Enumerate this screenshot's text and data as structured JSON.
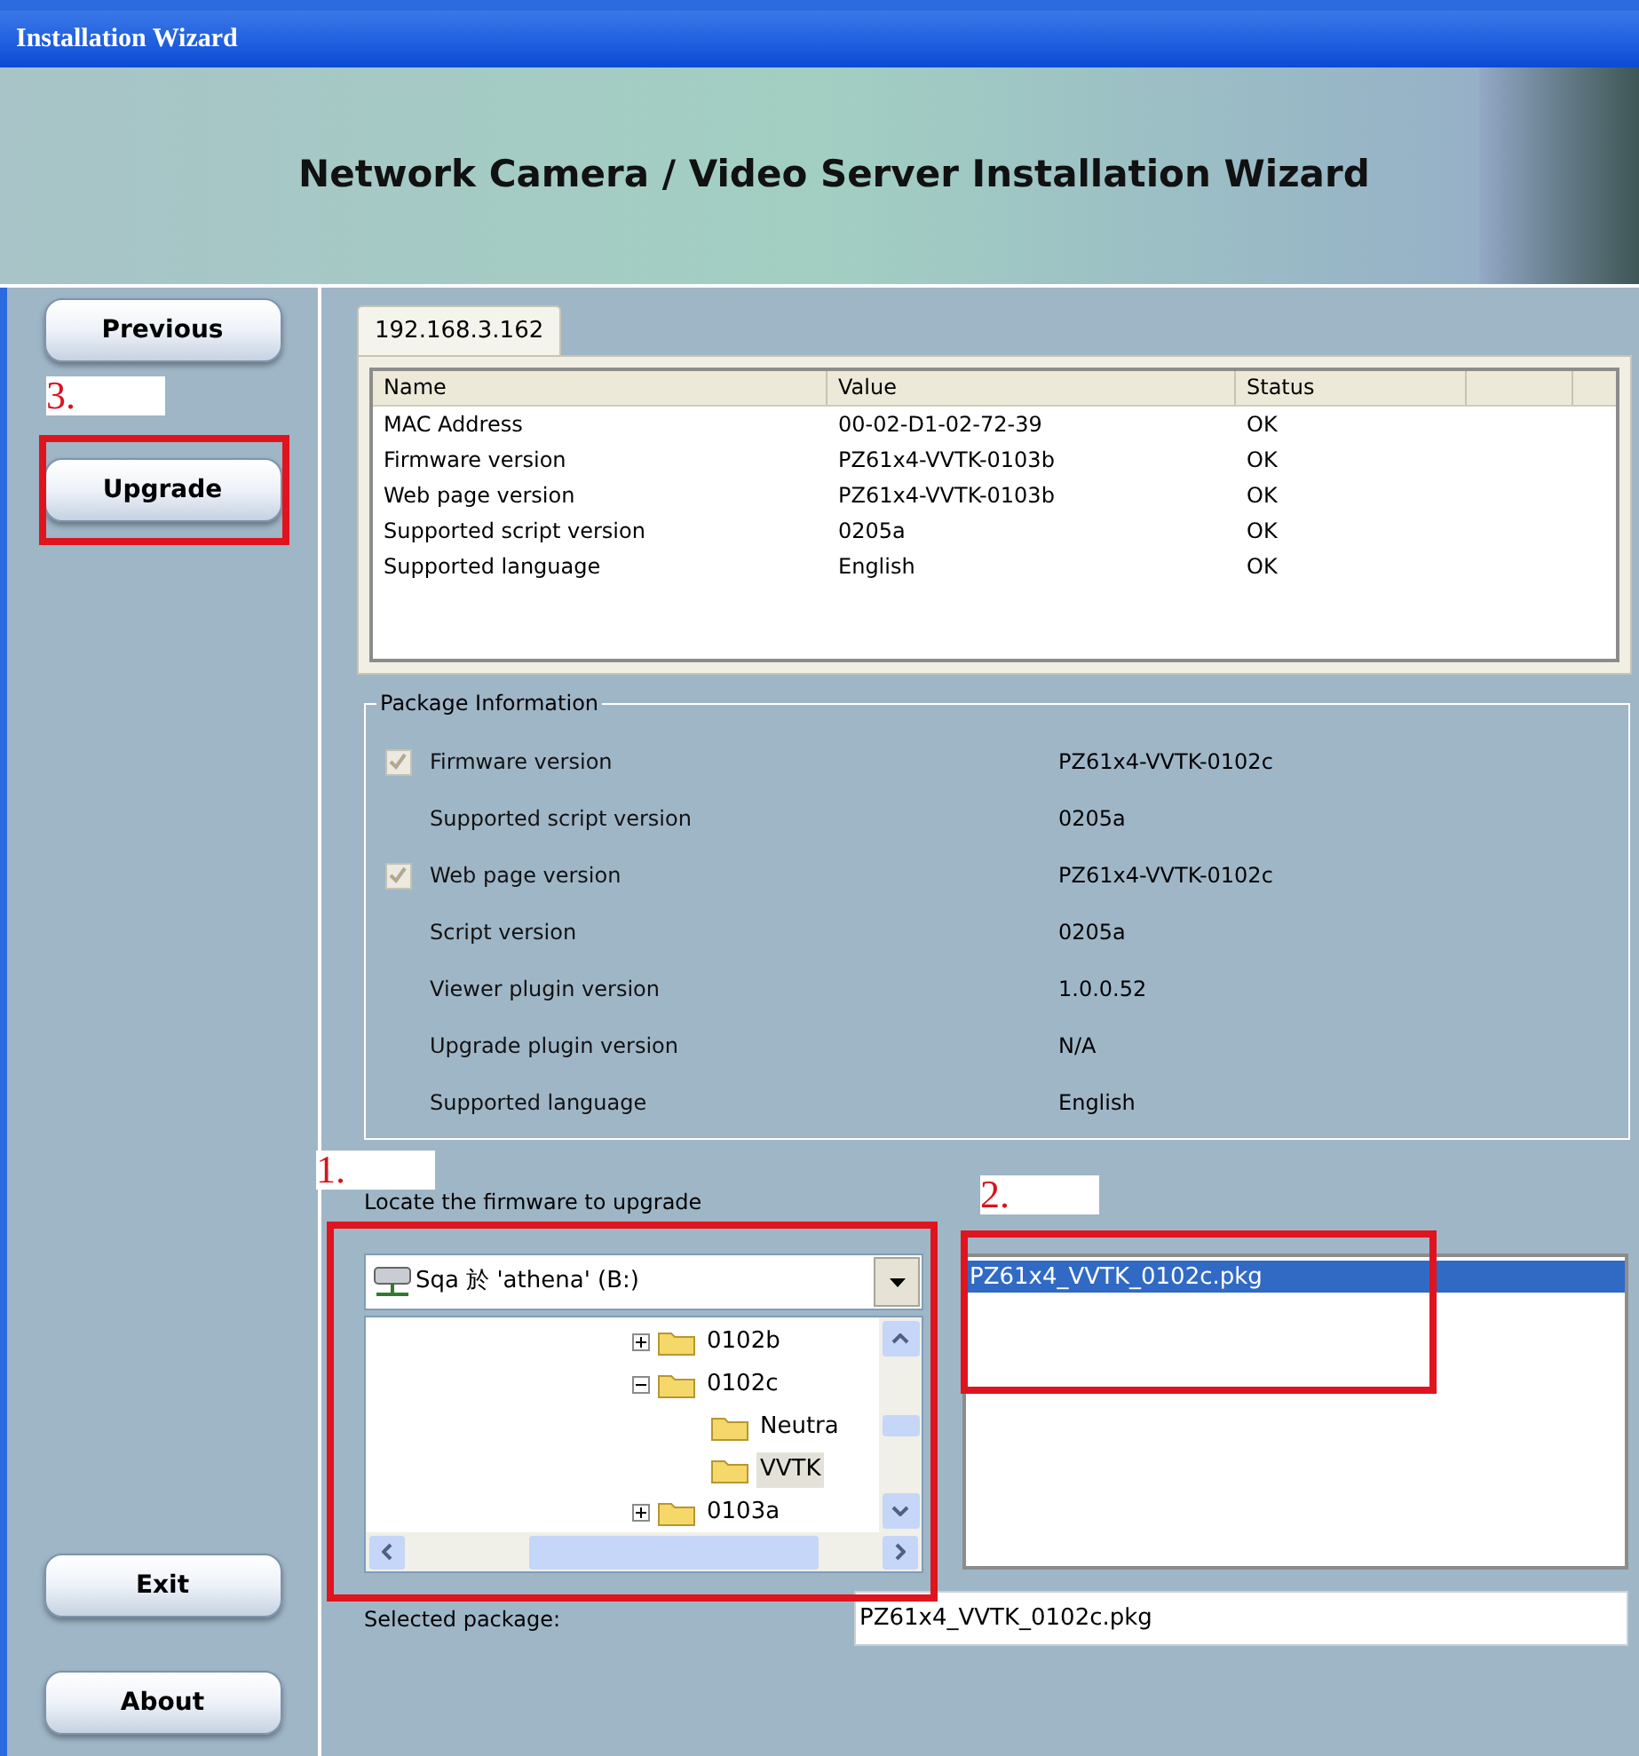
{
  "window": {
    "title": "Installation Wizard"
  },
  "banner": {
    "title": "Network Camera / Video Server Installation Wizard"
  },
  "sidebar": {
    "top_buttons": [
      "Previous",
      "Upgrade"
    ],
    "bottom_buttons": [
      "Exit",
      "About"
    ]
  },
  "device_tab": {
    "label": "192.168.3.162",
    "selected": true
  },
  "device_table": {
    "columns": [
      "Name",
      "Value",
      "Status"
    ],
    "rows": [
      [
        "MAC Address",
        "00-02-D1-02-72-39",
        "OK"
      ],
      [
        "Firmware version",
        "PZ61x4-VVTK-0103b",
        "OK"
      ],
      [
        "Web page version",
        "PZ61x4-VVTK-0103b",
        "OK"
      ],
      [
        "Supported script version",
        "0205a",
        "OK"
      ],
      [
        "Supported language",
        "English",
        "OK"
      ]
    ]
  },
  "package_info": {
    "title": "Package Information",
    "rows": [
      {
        "kind": "checkbox",
        "checked": true,
        "label": "Firmware version",
        "value": "PZ61x4-VVTK-0102c"
      },
      {
        "kind": "plain",
        "label": "Supported script version",
        "value": "0205a"
      },
      {
        "kind": "checkbox",
        "checked": true,
        "label": "Web page version",
        "value": "PZ61x4-VVTK-0102c"
      },
      {
        "kind": "plain",
        "label": "Script version",
        "value": "0205a"
      },
      {
        "kind": "plain",
        "label": "Viewer plugin version",
        "value": "1.0.0.52"
      },
      {
        "kind": "plain",
        "label": "Upgrade plugin version",
        "value": "N/A"
      },
      {
        "kind": "plain",
        "label": "Supported language",
        "value": "English"
      }
    ]
  },
  "locate": {
    "label": "Locate the firmware to upgrade",
    "drive": "Sqa 於 'athena' (B:)",
    "tree": [
      {
        "name": "0102b",
        "expanded": false,
        "selected": false
      },
      {
        "name": "0102c",
        "expanded": true,
        "selected": false,
        "children": [
          {
            "name": "Neutra",
            "selected": false
          },
          {
            "name": "VVTK",
            "selected": true
          }
        ]
      },
      {
        "name": "0103a",
        "expanded": false,
        "selected": false
      }
    ],
    "files": [
      {
        "name": "PZ61x4_VVTK_0102c.pkg",
        "selected": true
      }
    ]
  },
  "selected_package": {
    "label": "Selected package:",
    "value": "PZ61x4_VVTK_0102c.pkg"
  },
  "annotations": [
    "1.",
    "2.",
    "3."
  ]
}
